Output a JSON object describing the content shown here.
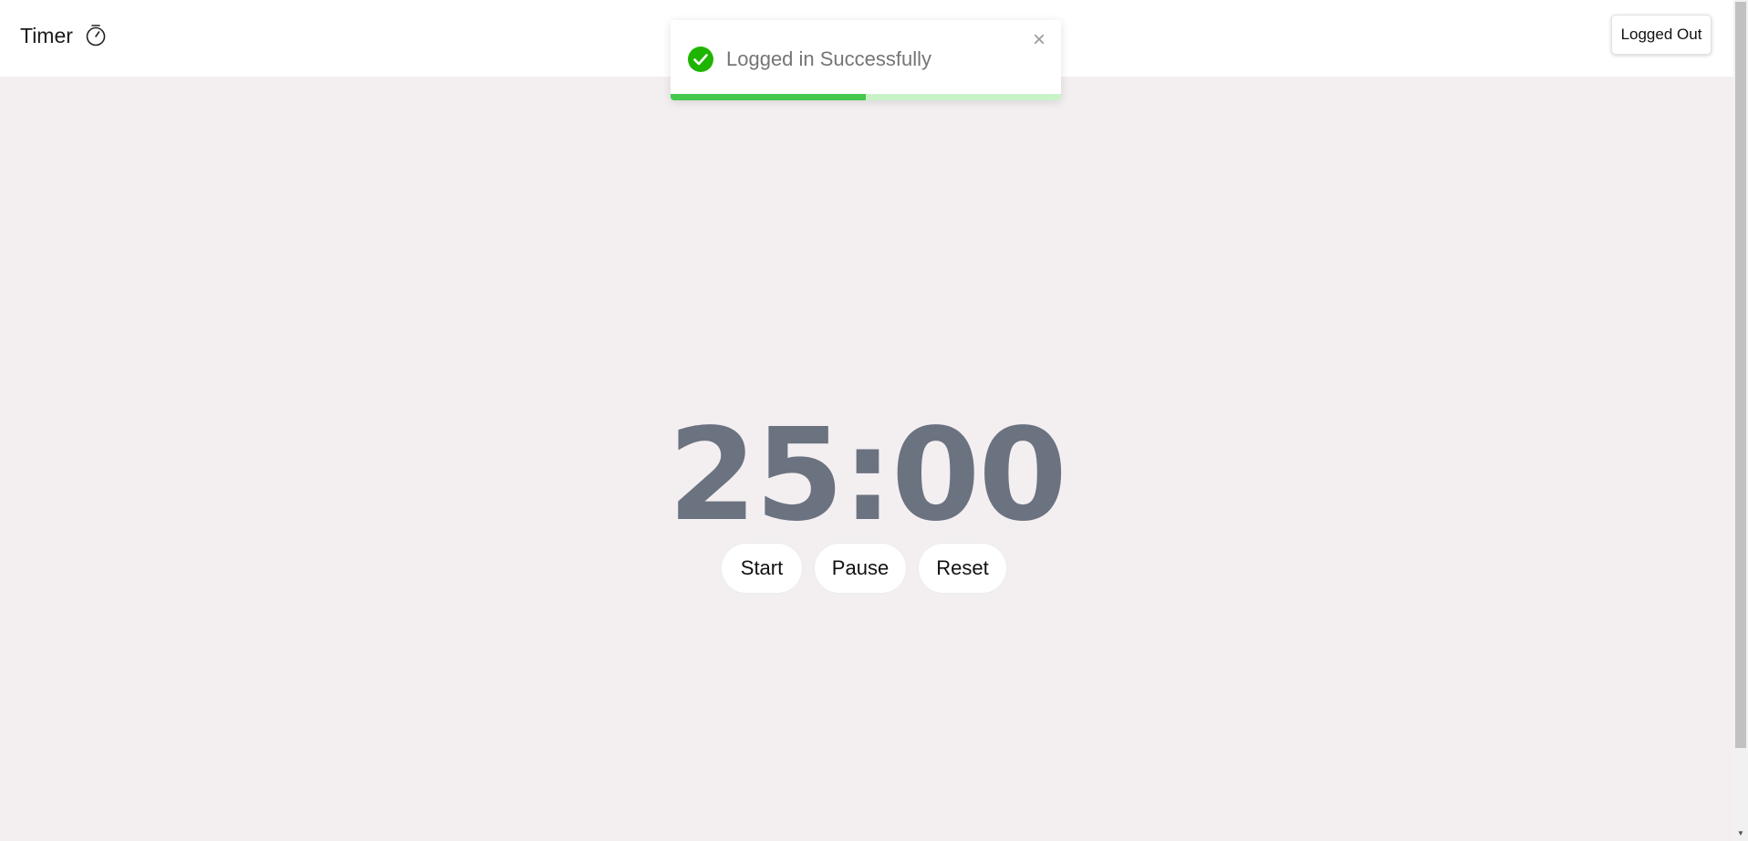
{
  "header": {
    "title": "Timer",
    "title_icon": "stopwatch-icon",
    "auth_button_label": "Logged Out"
  },
  "toast": {
    "message": "Logged in Successfully",
    "status_icon": "check-circle-icon",
    "close_icon": "close-icon",
    "close_glyph": "×",
    "progress_fraction": 0.5,
    "colors": {
      "success": "#1eb500",
      "progress_fill": "#45c84d",
      "progress_track": "#c8f3c9"
    }
  },
  "timer": {
    "display": "25:00",
    "color": "#6b7280"
  },
  "controls": {
    "start_label": "Start",
    "pause_label": "Pause",
    "reset_label": "Reset"
  },
  "colors": {
    "background": "#f3eff1",
    "header_background": "#ffffff"
  }
}
